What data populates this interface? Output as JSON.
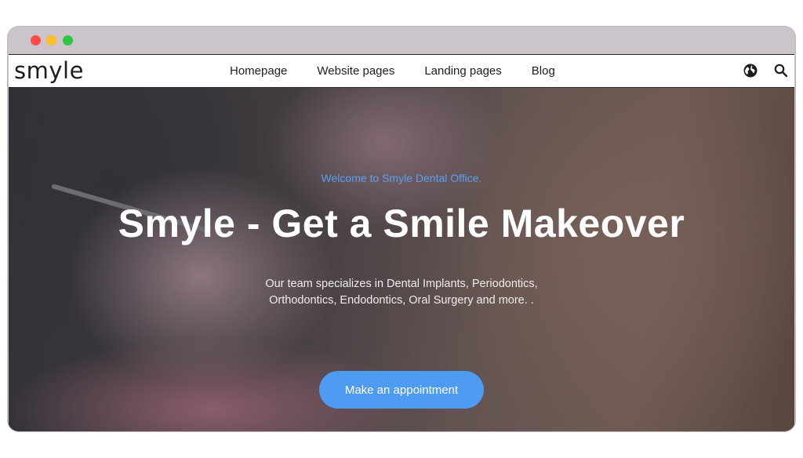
{
  "window": {
    "controls": [
      "close",
      "minimize",
      "maximize"
    ],
    "colors": {
      "close": "#fe4b46",
      "minimize": "#fcbf27",
      "maximize": "#2bc840"
    }
  },
  "navbar": {
    "logo": "smyle",
    "links": [
      "Homepage",
      "Website pages",
      "Landing pages",
      "Blog"
    ],
    "icons": [
      "globe-icon",
      "search-icon"
    ]
  },
  "hero": {
    "eyebrow": "Welcome to Smyle Dental Office.",
    "title": "Smyle - Get a Smile Makeover",
    "subtitle_line1": "Our team specializes in Dental Implants, Periodontics,",
    "subtitle_line2": "Orthodontics, Endodontics, Oral Surgery and more. .",
    "cta_label": "Make an appointment"
  },
  "colors": {
    "accent": "#4e9bf3",
    "eyebrow": "#5b9ff2"
  }
}
